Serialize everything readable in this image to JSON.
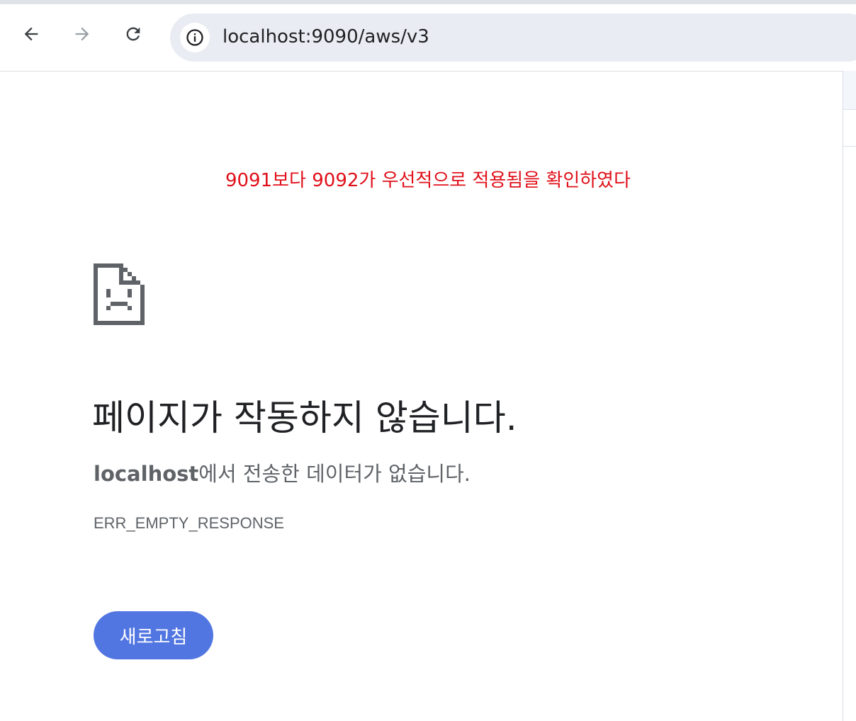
{
  "browser": {
    "url": "localhost:9090/aws/v3",
    "icons": {
      "back": "arrow-left-icon",
      "forward": "arrow-right-icon",
      "reload": "reload-icon",
      "info": "info-icon"
    }
  },
  "annotation": {
    "text": "9091보다 9092가 우선적으로 적용됨을 확인하였다",
    "color": "#e0101a"
  },
  "error_page": {
    "icon": "sad-file-icon",
    "title": "페이지가 작동하지 않습니다.",
    "host": "localhost",
    "message": "에서 전송한 데이터가 없습니다.",
    "error_code": "ERR_EMPTY_RESPONSE",
    "reload_label": "새로고침",
    "accent_color": "#5276e1"
  }
}
